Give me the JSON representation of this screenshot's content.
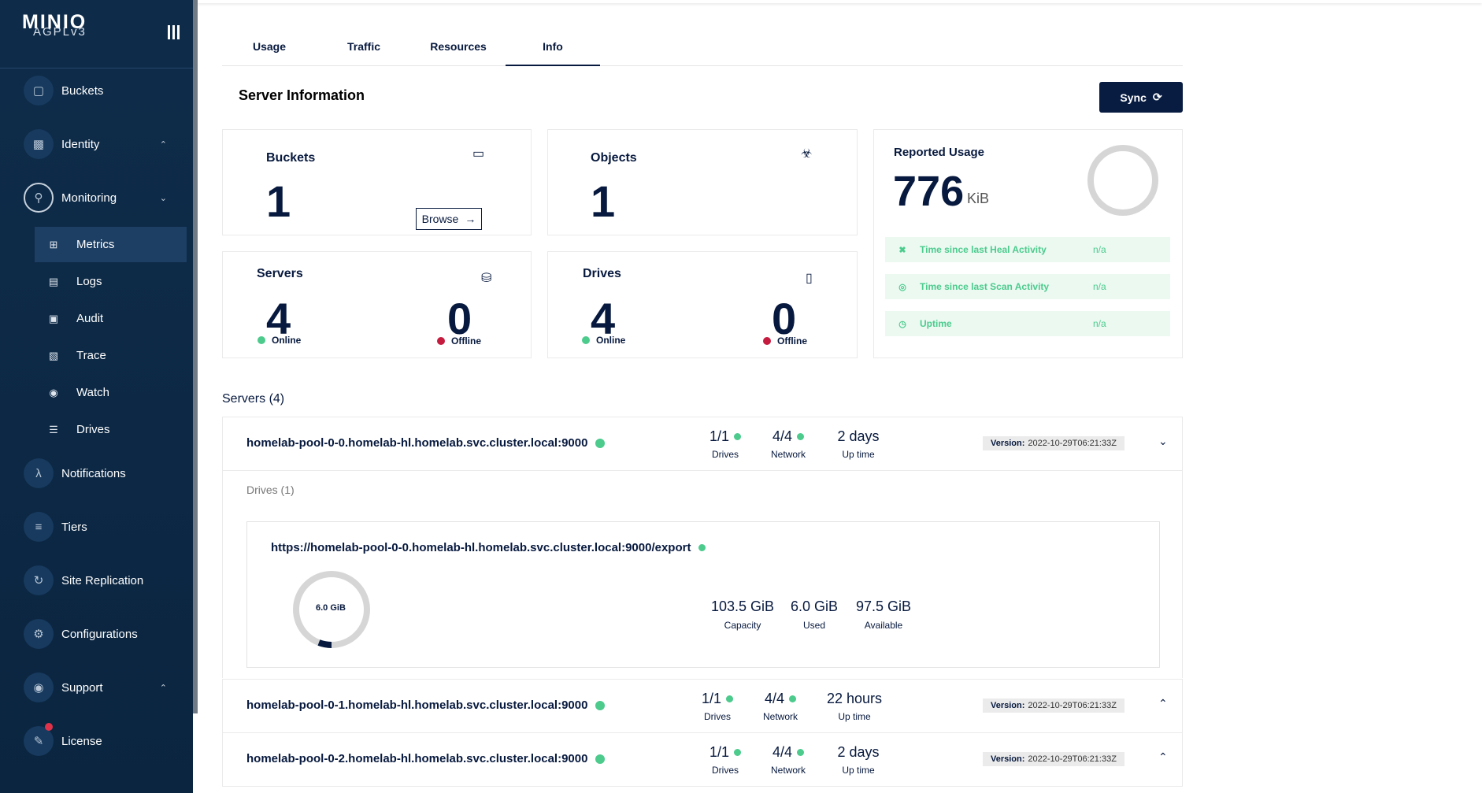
{
  "sidebar": {
    "logo": "MINIO",
    "license": "AGPLv3",
    "items": [
      {
        "label": "Buckets",
        "icon": "bucket-icon"
      },
      {
        "label": "Identity",
        "icon": "identity-icon"
      },
      {
        "label": "Monitoring",
        "icon": "monitoring-icon"
      },
      {
        "label": "Notifications",
        "icon": "lambda-icon"
      },
      {
        "label": "Tiers",
        "icon": "tiers-icon"
      },
      {
        "label": "Site Replication",
        "icon": "replication-icon"
      },
      {
        "label": "Configurations",
        "icon": "gear-icon"
      },
      {
        "label": "Support",
        "icon": "support-icon"
      },
      {
        "label": "License",
        "icon": "license-icon"
      }
    ],
    "monitoring_sub": [
      {
        "label": "Metrics",
        "icon": "metrics-icon"
      },
      {
        "label": "Logs",
        "icon": "logs-icon"
      },
      {
        "label": "Audit",
        "icon": "audit-icon"
      },
      {
        "label": "Trace",
        "icon": "trace-icon"
      },
      {
        "label": "Watch",
        "icon": "watch-icon"
      },
      {
        "label": "Drives",
        "icon": "drives-icon"
      }
    ]
  },
  "tabs": [
    "Usage",
    "Traffic",
    "Resources",
    "Info"
  ],
  "active_tab": "Info",
  "page_title": "Server Information",
  "sync_label": "Sync",
  "cards": {
    "buckets": {
      "title": "Buckets",
      "value": "1",
      "browse": "Browse"
    },
    "objects": {
      "title": "Objects",
      "value": "1"
    },
    "servers": {
      "title": "Servers",
      "online": "4",
      "offline": "0",
      "online_label": "Online",
      "offline_label": "Offline"
    },
    "drives": {
      "title": "Drives",
      "online": "4",
      "offline": "0",
      "online_label": "Online",
      "offline_label": "Offline"
    },
    "usage": {
      "title": "Reported Usage",
      "value": "776",
      "unit": "KiB"
    }
  },
  "activities": [
    {
      "label": "Time since last Heal Activity",
      "value": "n/a"
    },
    {
      "label": "Time since last Scan Activity",
      "value": "n/a"
    },
    {
      "label": "Uptime",
      "value": "n/a"
    }
  ],
  "servers_heading": "Servers (4)",
  "servers": [
    {
      "name": "homelab-pool-0-0.homelab-hl.homelab.svc.cluster.local:9000",
      "drives": "1/1",
      "network": "4/4",
      "uptime": "2 days",
      "version": "2022-10-29T06:21:33Z",
      "expanded": true
    },
    {
      "name": "homelab-pool-0-1.homelab-hl.homelab.svc.cluster.local:9000",
      "drives": "1/1",
      "network": "4/4",
      "uptime": "22 hours",
      "version": "2022-10-29T06:21:33Z",
      "expanded": false
    },
    {
      "name": "homelab-pool-0-2.homelab-hl.homelab.svc.cluster.local:9000",
      "drives": "1/1",
      "network": "4/4",
      "uptime": "2 days",
      "version": "2022-10-29T06:21:33Z",
      "expanded": false
    }
  ],
  "labels": {
    "drives": "Drives",
    "network": "Network",
    "uptime": "Up time",
    "version": "Version:"
  },
  "drives_section": {
    "heading": "Drives (1)",
    "path": "https://homelab-pool-0-0.homelab-hl.homelab.svc.cluster.local:9000/export",
    "donut_label": "6.0 GiB",
    "used_fraction": 0.058,
    "capacity": "103.5 GiB",
    "used": "6.0 GiB",
    "available": "97.5 GiB",
    "capacity_label": "Capacity",
    "used_label": "Used",
    "available_label": "Available"
  },
  "colors": {
    "sidebar": "#0e2c4a",
    "accent": "#081c42",
    "online": "#4ccb8d",
    "offline": "#c51b3f"
  }
}
